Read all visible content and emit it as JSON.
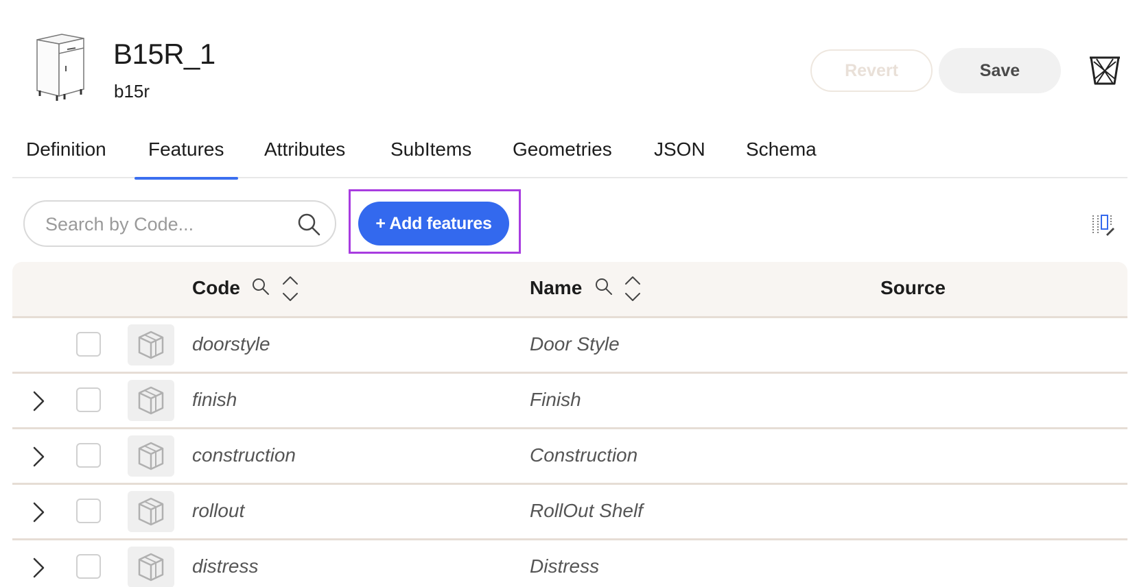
{
  "header": {
    "title": "B15R_1",
    "subtitle": "b15r",
    "revert_label": "Revert",
    "save_label": "Save",
    "thumbnail_icon": "cabinet-icon",
    "delete_icon": "trash-icon"
  },
  "tabs": [
    {
      "label": "Definition",
      "active": false
    },
    {
      "label": "Features",
      "active": true
    },
    {
      "label": "Attributes",
      "active": false
    },
    {
      "label": "SubItems",
      "active": false
    },
    {
      "label": "Geometries",
      "active": false
    },
    {
      "label": "JSON",
      "active": false
    },
    {
      "label": "Schema",
      "active": false
    }
  ],
  "toolbar": {
    "search_placeholder": "Search by Code...",
    "add_label": "+ Add features",
    "column_edit_icon": "column-settings-icon"
  },
  "table": {
    "columns": {
      "code": "Code",
      "name": "Name",
      "source": "Source"
    },
    "rows": [
      {
        "code": "doorstyle",
        "name": "Door Style",
        "expandable": false
      },
      {
        "code": "finish",
        "name": "Finish",
        "expandable": true
      },
      {
        "code": "construction",
        "name": "Construction",
        "expandable": true
      },
      {
        "code": "rollout",
        "name": "RollOut Shelf",
        "expandable": true
      },
      {
        "code": "distress",
        "name": "Distress",
        "expandable": true
      }
    ]
  },
  "colors": {
    "accent": "#3369ee",
    "highlight": "#a83ce0",
    "row_divider": "#e6ddd5",
    "header_bg": "#f8f5f2"
  }
}
